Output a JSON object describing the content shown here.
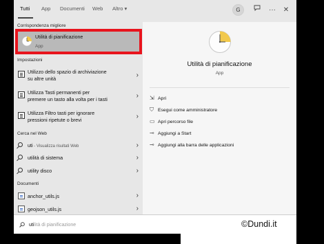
{
  "tabs": [
    {
      "label": "Tutti"
    },
    {
      "label": "App"
    },
    {
      "label": "Documenti"
    },
    {
      "label": "Web"
    },
    {
      "label": "Altro ▾"
    }
  ],
  "avatar": "G",
  "topbar_icons": [
    "feedback-icon",
    "more-icon",
    "close-icon"
  ],
  "sections": {
    "best": "Corrispondenza migliore",
    "settings": "Impostazioni",
    "web": "Cerca nel Web",
    "docs": "Documenti"
  },
  "best_match": {
    "title": "Utilità di pianificazione",
    "subtitle": "App"
  },
  "settings_items": [
    {
      "line1": "Utilizzo dello spazio di archiviazione",
      "line2": "su altre unità"
    },
    {
      "line1": "Utilizza Tasti permanenti per",
      "line2": "premere un tasto alla volta per i tasti"
    },
    {
      "line1": "Utilizza Filtro tasti per ignorare",
      "line2": "pressioni ripetute o brevi"
    }
  ],
  "web_items": [
    {
      "text": "uti",
      "hint": " - Visualizza risultati Web"
    },
    {
      "text": "utilità di sistema",
      "hint": ""
    },
    {
      "text": "utility disco",
      "hint": ""
    }
  ],
  "doc_items": [
    {
      "text": "anchor_utils.js"
    },
    {
      "text": "geojson_utils.js"
    }
  ],
  "right_pane": {
    "title": "Utilità di pianificazione",
    "subtitle": "App",
    "actions": [
      {
        "label": "Apri",
        "icon": "open-icon"
      },
      {
        "label": "Esegui come amministratore",
        "icon": "shield-icon"
      },
      {
        "label": "Apri percorso file",
        "icon": "folder-icon"
      },
      {
        "label": "Aggiungi a Start",
        "icon": "pin-icon"
      },
      {
        "label": "Aggiungi alla barra delle applicazioni",
        "icon": "pin-icon"
      }
    ]
  },
  "search": {
    "typed": "uti",
    "ghost": "lità di pianificazione"
  },
  "watermark": "©Dundi.it",
  "colors": {
    "highlight_border": "#e8141d",
    "selected_bg": "#b9b9b9",
    "clock_face": "#f2c94c"
  }
}
